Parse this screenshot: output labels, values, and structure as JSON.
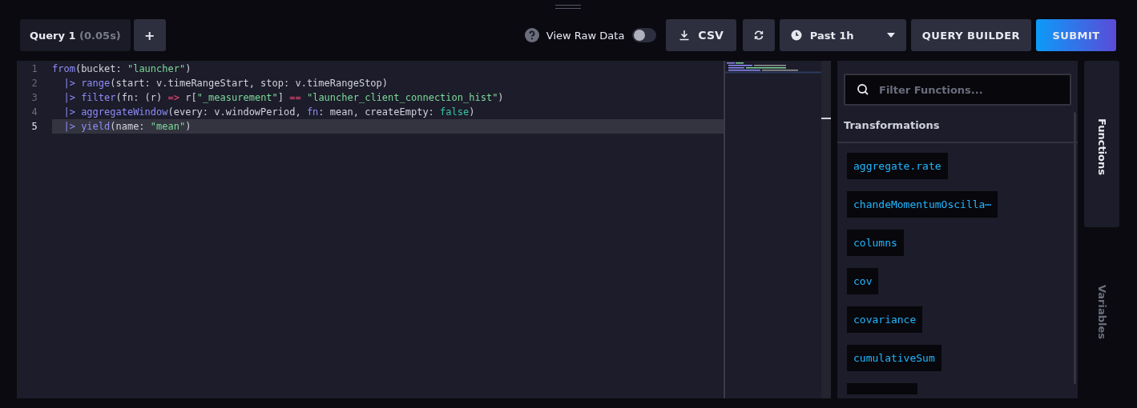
{
  "query_tab": {
    "label": "Query 1",
    "timing": "(0.05s)"
  },
  "add_button": {
    "label": "+"
  },
  "raw_data_toggle": {
    "label": "View Raw Data",
    "on": false
  },
  "csv_button": {
    "label": "CSV"
  },
  "time_range": {
    "label": "Past 1h"
  },
  "query_builder_button": {
    "label": "QUERY BUILDER"
  },
  "submit_button": {
    "label": "SUBMIT"
  },
  "editor": {
    "lines": [
      {
        "number": "1",
        "current": false,
        "tokens": [
          {
            "kind": "fn",
            "text": "from"
          },
          {
            "kind": "plain",
            "text": "(bucket: "
          },
          {
            "kind": "str",
            "text": "\"launcher\""
          },
          {
            "kind": "plain",
            "text": ")"
          }
        ]
      },
      {
        "number": "2",
        "current": false,
        "tokens": [
          {
            "kind": "pipe",
            "text": "  |> "
          },
          {
            "kind": "fn",
            "text": "range"
          },
          {
            "kind": "plain",
            "text": "(start: v.timeRangeStart, stop: v.timeRangeStop)"
          }
        ]
      },
      {
        "number": "3",
        "current": false,
        "tokens": [
          {
            "kind": "pipe",
            "text": "  |> "
          },
          {
            "kind": "fn",
            "text": "filter"
          },
          {
            "kind": "plain",
            "text": "(fn: (r) "
          },
          {
            "kind": "op",
            "text": "=>"
          },
          {
            "kind": "plain",
            "text": " r["
          },
          {
            "kind": "str",
            "text": "\"_measurement\""
          },
          {
            "kind": "plain",
            "text": "] "
          },
          {
            "kind": "op",
            "text": "=="
          },
          {
            "kind": "str",
            "text": " \"launcher_client_connection_hist\""
          },
          {
            "kind": "plain",
            "text": ")"
          }
        ]
      },
      {
        "number": "4",
        "current": false,
        "tokens": [
          {
            "kind": "pipe",
            "text": "  |> "
          },
          {
            "kind": "fn",
            "text": "aggregateWindow"
          },
          {
            "kind": "plain",
            "text": "(every: v.windowPeriod, "
          },
          {
            "kind": "fn",
            "text": "fn"
          },
          {
            "kind": "plain",
            "text": ": mean, createEmpty: "
          },
          {
            "kind": "bool",
            "text": "false"
          },
          {
            "kind": "plain",
            "text": ")"
          }
        ]
      },
      {
        "number": "5",
        "current": true,
        "tokens": [
          {
            "kind": "pipe",
            "text": "  |> "
          },
          {
            "kind": "fn",
            "text": "yield"
          },
          {
            "kind": "plain",
            "text": "(name: "
          },
          {
            "kind": "str",
            "text": "\"mean\""
          },
          {
            "kind": "plain",
            "text": ")"
          }
        ]
      }
    ]
  },
  "functions_panel": {
    "search": {
      "placeholder": "Filter Functions..."
    },
    "section": "Transformations",
    "items": [
      {
        "name": "aggregate.rate"
      },
      {
        "name": "chandeMomentumOscilla⋯"
      },
      {
        "name": "columns"
      },
      {
        "name": "cov"
      },
      {
        "name": "covariance"
      },
      {
        "name": "cumulativeSum"
      }
    ],
    "more_below": true
  },
  "side_tabs": [
    {
      "label": "Functions",
      "selected": true
    },
    {
      "label": "Variables",
      "selected": false
    }
  ]
}
